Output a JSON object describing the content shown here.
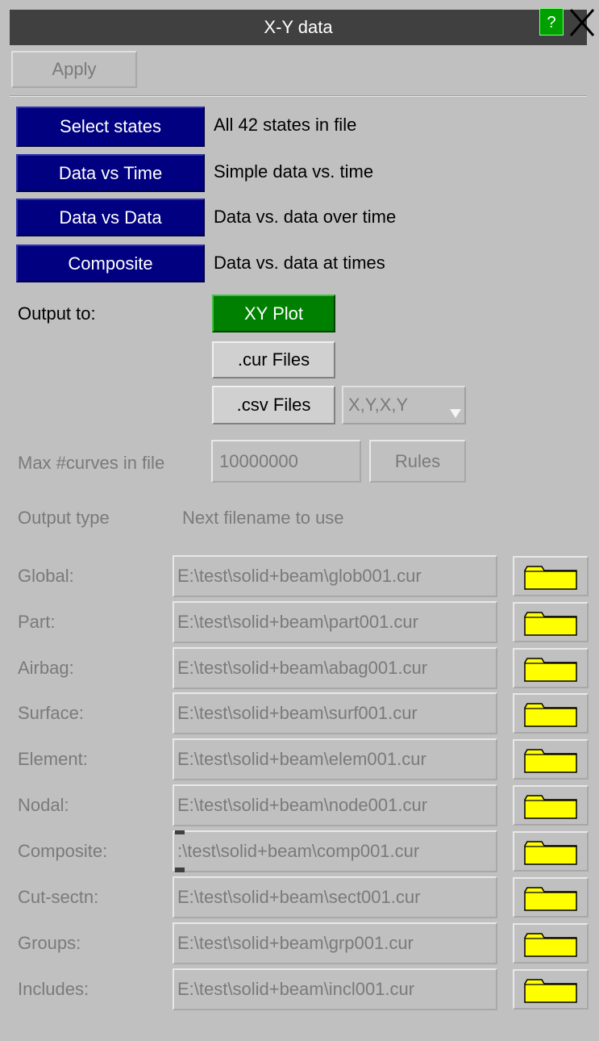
{
  "window": {
    "title": "X-Y data",
    "help_label": "?"
  },
  "toolbar": {
    "apply_label": "Apply"
  },
  "actions": [
    {
      "label": "Select states",
      "desc": "All 42 states in file"
    },
    {
      "label": "Data vs Time",
      "desc": "Simple data vs. time"
    },
    {
      "label": "Data vs Data",
      "desc": "Data vs. data over time"
    },
    {
      "label": "Composite",
      "desc": "Data vs. data at times"
    }
  ],
  "output": {
    "label": "Output to:",
    "xyplot_label": "XY Plot",
    "cur_label": ".cur Files",
    "csv_label": ".csv Files",
    "csv_format": "X,Y,X,Y"
  },
  "max_curves": {
    "label": "Max #curves in file",
    "value": "10000000",
    "rules_label": "Rules"
  },
  "headers": {
    "output_type": "Output type",
    "next_filename": "Next filename to use"
  },
  "rows": [
    {
      "label": "Global:",
      "file": "E:\\test\\solid+beam\\glob001.cur"
    },
    {
      "label": "Part:",
      "file": "E:\\test\\solid+beam\\part001.cur"
    },
    {
      "label": "Airbag:",
      "file": "E:\\test\\solid+beam\\abag001.cur"
    },
    {
      "label": "Surface:",
      "file": "E:\\test\\solid+beam\\surf001.cur"
    },
    {
      "label": "Element:",
      "file": "E:\\test\\solid+beam\\elem001.cur"
    },
    {
      "label": "Nodal:",
      "file": "E:\\test\\solid+beam\\node001.cur"
    },
    {
      "label": "Composite:",
      "file": ":\\test\\solid+beam\\comp001.cur"
    },
    {
      "label": "Cut-sectn:",
      "file": "E:\\test\\solid+beam\\sect001.cur"
    },
    {
      "label": "Groups:",
      "file": "E:\\test\\solid+beam\\grp001.cur"
    },
    {
      "label": "Includes:",
      "file": "E:\\test\\solid+beam\\incl001.cur"
    }
  ],
  "colors": {
    "background": "#c0c0c0",
    "titlebar": "#404040",
    "action_blue": "#000080",
    "active_green": "#008000",
    "folder_yellow": "#ffff00"
  }
}
